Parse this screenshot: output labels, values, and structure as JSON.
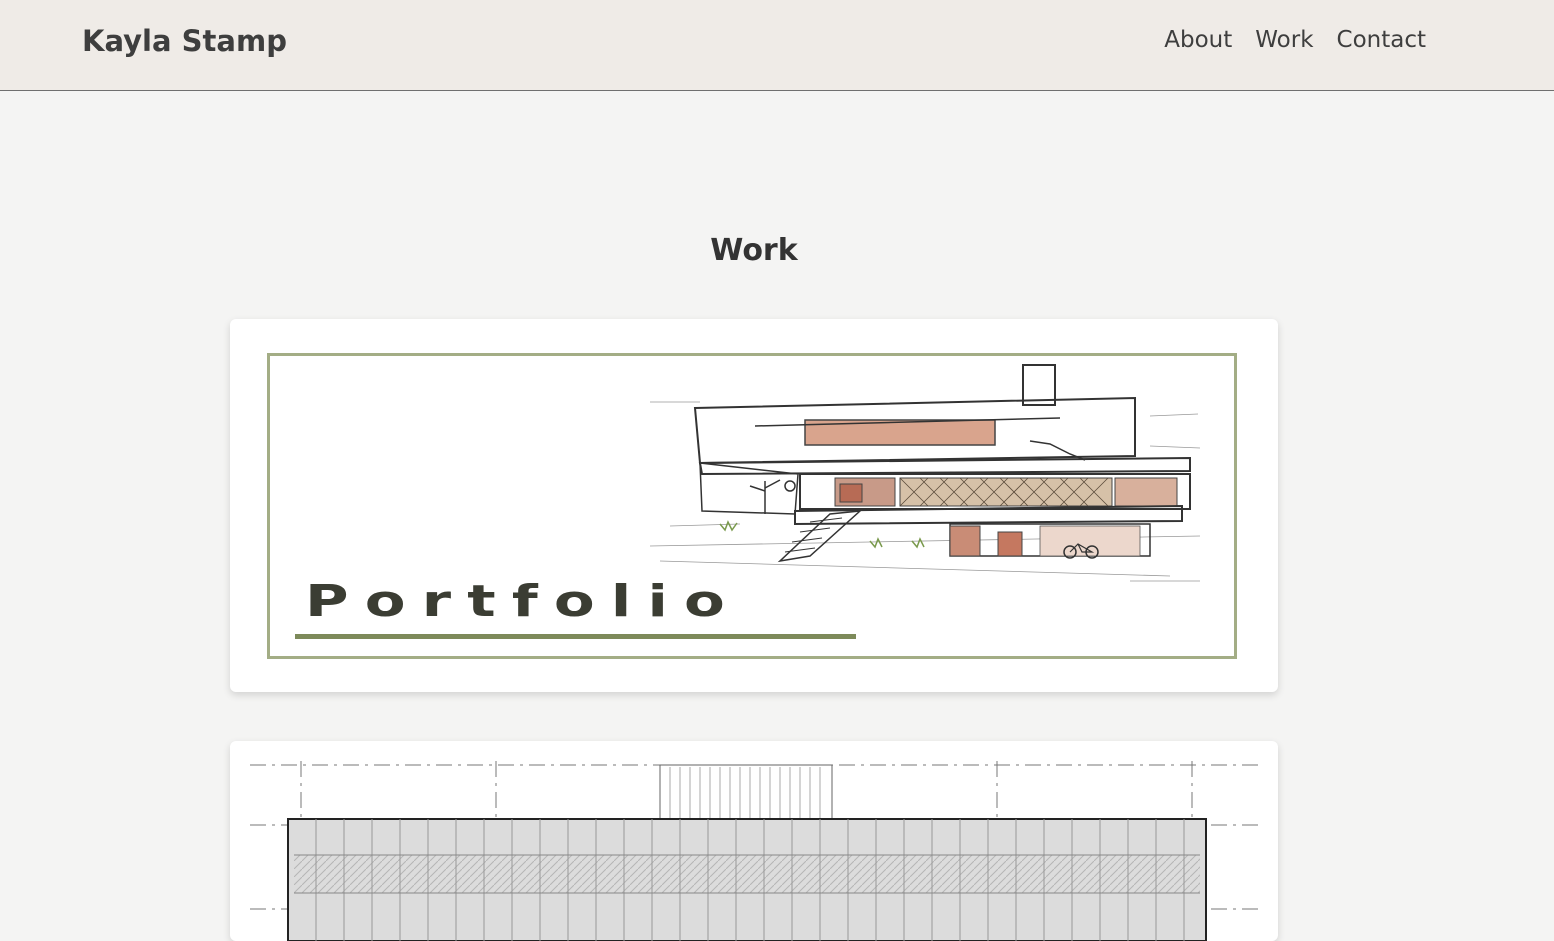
{
  "header": {
    "brand": "Kayla Stamp",
    "nav": [
      {
        "label": "About"
      },
      {
        "label": "Work"
      },
      {
        "label": "Contact"
      }
    ]
  },
  "main": {
    "title": "Work",
    "cards": [
      {
        "banner_text": "Portfolio",
        "image": "house-sketch"
      },
      {
        "image": "architectural-floor-plan"
      }
    ]
  },
  "colors": {
    "header_bg": "#efebe7",
    "page_bg": "#f4f4f3",
    "banner_border": "#a3ad85",
    "banner_underline": "#7d8a5a"
  }
}
